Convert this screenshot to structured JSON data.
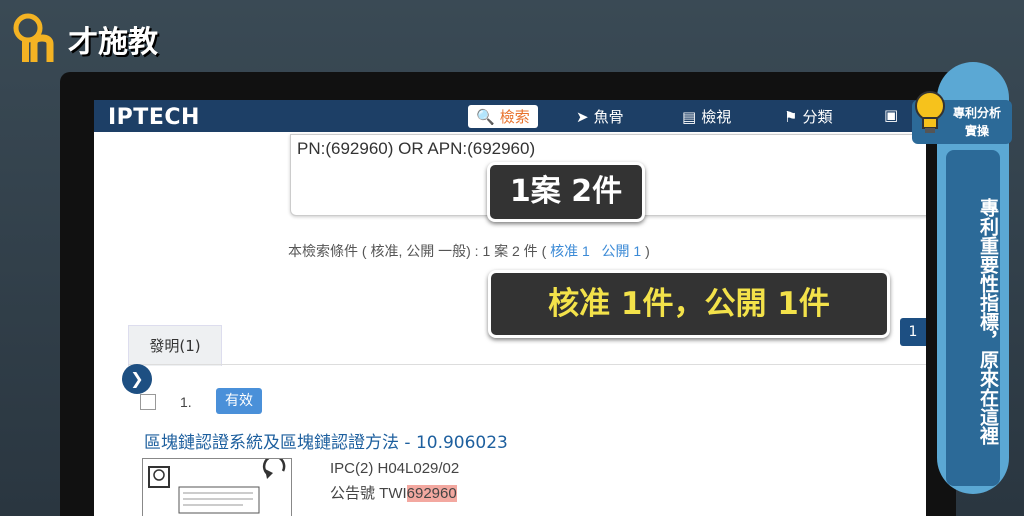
{
  "brand": {
    "text": "才施教"
  },
  "nav": {
    "logo": "IPTECH",
    "items": [
      {
        "label": "檢索",
        "icon": "search-icon"
      },
      {
        "label": "魚骨",
        "icon": "fishbone-icon"
      },
      {
        "label": "檢視",
        "icon": "list-view-icon"
      },
      {
        "label": "分類",
        "icon": "classify-icon"
      }
    ]
  },
  "query": {
    "text": "PN:(692960) OR APN:(692960)"
  },
  "callouts": {
    "summary": "1案 2件",
    "detail": "核准 1件，公開 1件"
  },
  "condition": {
    "text": "本檢索條件 ( 核准, 公開 一般) : 1 案  2 件 (",
    "approved": "核准 1",
    "published": "公開 1",
    "close": ")"
  },
  "tab": {
    "label": "發明(1)"
  },
  "pagination": {
    "current": "1"
  },
  "result": {
    "number": "1.",
    "status": "有效",
    "title": "區塊鏈認證系統及區塊鏈認證方法 - 10.906023",
    "ipc_label": "IPC(2) H04L029/02",
    "pub_prefix": "公告號 TWI",
    "pub_highlight": "692960"
  },
  "side": {
    "badge_line1": "專利分析",
    "badge_line2": "實操",
    "vertical_text": "專利重要性指標，原來在這裡"
  }
}
